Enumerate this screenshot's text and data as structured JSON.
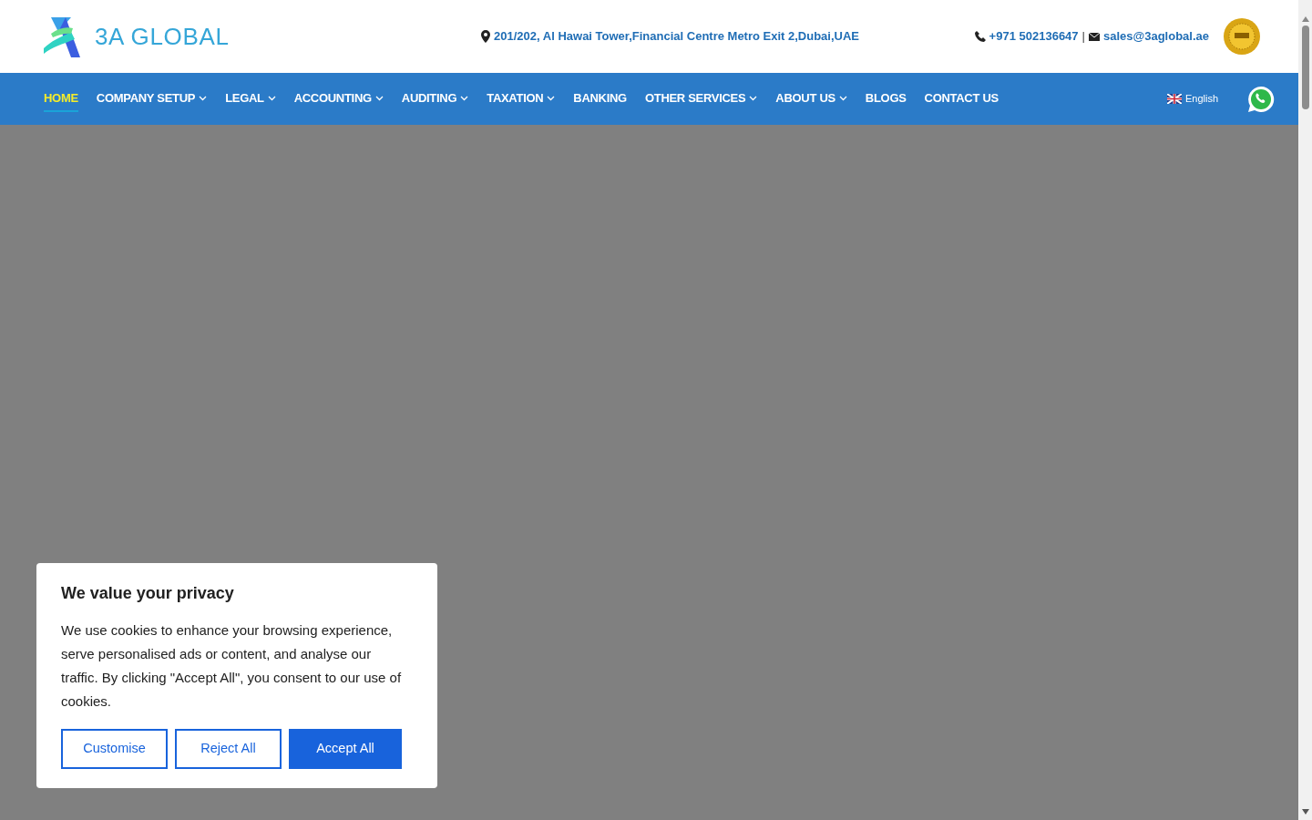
{
  "header": {
    "logo_text": "3A GLOBAL",
    "address": "201/202, Al Hawai Tower,Financial Centre Metro Exit 2,Dubai,UAE",
    "phone": "+971 502136647",
    "separator": "|",
    "email": "sales@3aglobal.ae"
  },
  "nav": {
    "items": [
      {
        "label": "HOME",
        "selected": true,
        "dropdown": false
      },
      {
        "label": "COMPANY SETUP",
        "selected": false,
        "dropdown": true
      },
      {
        "label": "LEGAL",
        "selected": false,
        "dropdown": true
      },
      {
        "label": "ACCOUNTING",
        "selected": false,
        "dropdown": true
      },
      {
        "label": "AUDITING",
        "selected": false,
        "dropdown": true
      },
      {
        "label": "TAXATION",
        "selected": false,
        "dropdown": true
      },
      {
        "label": "BANKING",
        "selected": false,
        "dropdown": false
      },
      {
        "label": "OTHER SERVICES",
        "selected": false,
        "dropdown": true
      },
      {
        "label": "ABOUT US",
        "selected": false,
        "dropdown": true
      },
      {
        "label": "BLOGS",
        "selected": false,
        "dropdown": false
      },
      {
        "label": "CONTACT US",
        "selected": false,
        "dropdown": false
      }
    ],
    "language": "English"
  },
  "cookie_banner": {
    "title": "We value your privacy",
    "text": "We use cookies to enhance your browsing experience, serve personalised ads or content, and analyse our traffic. By clicking \"Accept All\", you consent to our use of cookies.",
    "buttons": [
      {
        "label": "Customise",
        "kind": "outline"
      },
      {
        "label": "Reject All",
        "kind": "outline"
      },
      {
        "label": "Accept All",
        "kind": "primary"
      }
    ]
  }
}
